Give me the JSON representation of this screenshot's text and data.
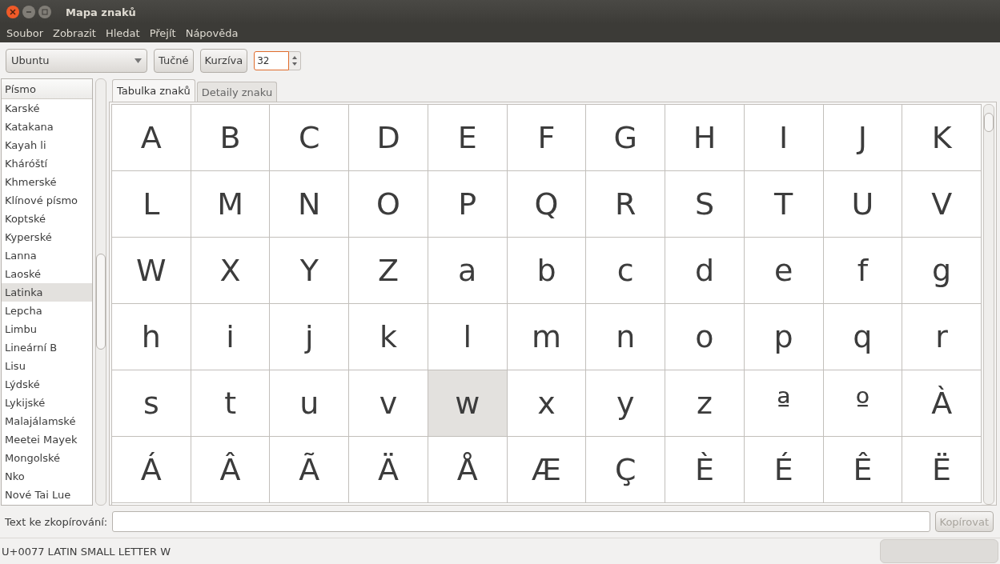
{
  "window": {
    "title": "Mapa znaků"
  },
  "menu": [
    "Soubor",
    "Zobrazit",
    "Hledat",
    "Přejít",
    "Nápověda"
  ],
  "toolbar": {
    "font": "Ubuntu",
    "bold_button": "Tučné",
    "italic_button": "Kurzíva",
    "size": "32"
  },
  "sidebar": {
    "header": "Písmo",
    "items": [
      {
        "label": "Karské",
        "selected": false
      },
      {
        "label": "Katakana",
        "selected": false
      },
      {
        "label": "Kayah li",
        "selected": false
      },
      {
        "label": "Kháróští",
        "selected": false
      },
      {
        "label": "Khmerské",
        "selected": false
      },
      {
        "label": "Klínové písmo",
        "selected": false
      },
      {
        "label": "Koptské",
        "selected": false
      },
      {
        "label": "Kyperské",
        "selected": false
      },
      {
        "label": "Lanna",
        "selected": false
      },
      {
        "label": "Laoské",
        "selected": false
      },
      {
        "label": "Latinka",
        "selected": true
      },
      {
        "label": "Lepcha",
        "selected": false
      },
      {
        "label": "Limbu",
        "selected": false
      },
      {
        "label": "Lineární B",
        "selected": false
      },
      {
        "label": "Lisu",
        "selected": false
      },
      {
        "label": "Lýdské",
        "selected": false
      },
      {
        "label": "Lykijské",
        "selected": false
      },
      {
        "label": "Malajálamské",
        "selected": false
      },
      {
        "label": "Meetei Mayek",
        "selected": false
      },
      {
        "label": "Mongolské",
        "selected": false
      },
      {
        "label": "Nko",
        "selected": false
      },
      {
        "label": "Nové Tai Lue",
        "selected": false
      }
    ]
  },
  "tabs": [
    {
      "label": "Tabulka znaků",
      "selected": true
    },
    {
      "label": "Detaily znaku",
      "selected": false
    }
  ],
  "grid": [
    {
      "char": "A",
      "selected": false
    },
    {
      "char": "B",
      "selected": false
    },
    {
      "char": "C",
      "selected": false
    },
    {
      "char": "D",
      "selected": false
    },
    {
      "char": "E",
      "selected": false
    },
    {
      "char": "F",
      "selected": false
    },
    {
      "char": "G",
      "selected": false
    },
    {
      "char": "H",
      "selected": false
    },
    {
      "char": "I",
      "selected": false
    },
    {
      "char": "J",
      "selected": false
    },
    {
      "char": "K",
      "selected": false
    },
    {
      "char": "L",
      "selected": false
    },
    {
      "char": "M",
      "selected": false
    },
    {
      "char": "N",
      "selected": false
    },
    {
      "char": "O",
      "selected": false
    },
    {
      "char": "P",
      "selected": false
    },
    {
      "char": "Q",
      "selected": false
    },
    {
      "char": "R",
      "selected": false
    },
    {
      "char": "S",
      "selected": false
    },
    {
      "char": "T",
      "selected": false
    },
    {
      "char": "U",
      "selected": false
    },
    {
      "char": "V",
      "selected": false
    },
    {
      "char": "W",
      "selected": false
    },
    {
      "char": "X",
      "selected": false
    },
    {
      "char": "Y",
      "selected": false
    },
    {
      "char": "Z",
      "selected": false
    },
    {
      "char": "a",
      "selected": false
    },
    {
      "char": "b",
      "selected": false
    },
    {
      "char": "c",
      "selected": false
    },
    {
      "char": "d",
      "selected": false
    },
    {
      "char": "e",
      "selected": false
    },
    {
      "char": "f",
      "selected": false
    },
    {
      "char": "g",
      "selected": false
    },
    {
      "char": "h",
      "selected": false
    },
    {
      "char": "i",
      "selected": false
    },
    {
      "char": "j",
      "selected": false
    },
    {
      "char": "k",
      "selected": false
    },
    {
      "char": "l",
      "selected": false
    },
    {
      "char": "m",
      "selected": false
    },
    {
      "char": "n",
      "selected": false
    },
    {
      "char": "o",
      "selected": false
    },
    {
      "char": "p",
      "selected": false
    },
    {
      "char": "q",
      "selected": false
    },
    {
      "char": "r",
      "selected": false
    },
    {
      "char": "s",
      "selected": false
    },
    {
      "char": "t",
      "selected": false
    },
    {
      "char": "u",
      "selected": false
    },
    {
      "char": "v",
      "selected": false
    },
    {
      "char": "w",
      "selected": true
    },
    {
      "char": "x",
      "selected": false
    },
    {
      "char": "y",
      "selected": false
    },
    {
      "char": "z",
      "selected": false
    },
    {
      "char": "ª",
      "selected": false
    },
    {
      "char": "º",
      "selected": false
    },
    {
      "char": "À",
      "selected": false
    },
    {
      "char": "Á",
      "selected": false
    },
    {
      "char": "Â",
      "selected": false
    },
    {
      "char": "Ã",
      "selected": false
    },
    {
      "char": "Ä",
      "selected": false
    },
    {
      "char": "Å",
      "selected": false
    },
    {
      "char": "Æ",
      "selected": false
    },
    {
      "char": "Ç",
      "selected": false
    },
    {
      "char": "È",
      "selected": false
    },
    {
      "char": "É",
      "selected": false
    },
    {
      "char": "Ê",
      "selected": false
    },
    {
      "char": "Ë",
      "selected": false
    }
  ],
  "copy": {
    "label": "Text ke zkopírování:",
    "button": "Kopírovat",
    "button_disabled": true
  },
  "status_bar": "U+0077 LATIN SMALL LETTER W"
}
